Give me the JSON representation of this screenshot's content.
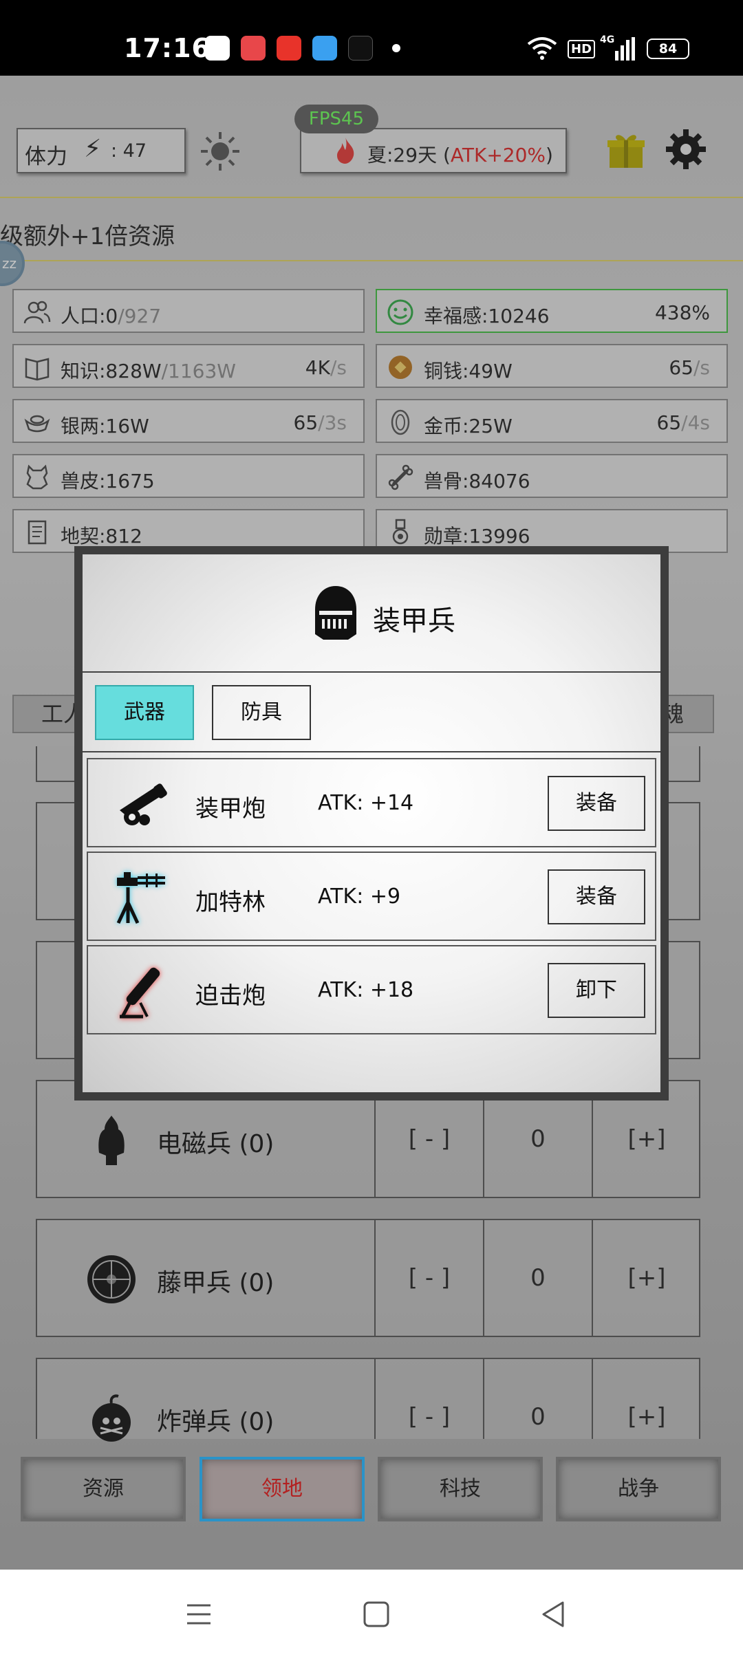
{
  "status_bar": {
    "time": "17:16",
    "network": "4G",
    "hd": "HD",
    "battery": "84"
  },
  "header": {
    "fps": "FPS45",
    "stamina_label": "体力",
    "stamina_bolt": "⚡",
    "stamina_value": ": 47",
    "season_prefix": "夏:29天 (",
    "season_atk": "ATK+20%",
    "season_suffix": ")",
    "bonus_text": "级额外+1倍资源"
  },
  "resources": {
    "population": {
      "name": "人口:0",
      "max": "/927"
    },
    "happiness": {
      "name": "幸福感:10246",
      "rate": "438%"
    },
    "knowledge": {
      "name": "知识:828W",
      "max": "/1163W",
      "rate": "4K",
      "unit": "/s"
    },
    "copper": {
      "name": "铜钱:49W",
      "rate": "65",
      "unit": "/s"
    },
    "silver": {
      "name": "银两:16W",
      "rate": "65",
      "unit": "/3s"
    },
    "gold": {
      "name": "金币:25W",
      "rate": "65",
      "unit": "/4s"
    },
    "hide": {
      "name": "兽皮:1675"
    },
    "bone": {
      "name": "兽骨:84076"
    },
    "deed": {
      "name": "地契:812"
    },
    "medal": {
      "name": "勋章:13996"
    }
  },
  "under_tabs": {
    "left": "工人",
    "right": "魂"
  },
  "units": [
    {
      "name": "电磁兵 (0)",
      "minus": "[ - ]",
      "count": "0",
      "plus": "[+]"
    },
    {
      "name": "藤甲兵 (0)",
      "minus": "[ - ]",
      "count": "0",
      "plus": "[+]"
    },
    {
      "name": "炸弹兵 (0)",
      "minus": "[ - ]",
      "count": "0",
      "plus": "[+]"
    }
  ],
  "bottom_nav": {
    "resources": "资源",
    "territory": "领地",
    "tech": "科技",
    "war": "战争"
  },
  "modal": {
    "title": "装甲兵",
    "tab_weapons": "武器",
    "tab_armor": "防具",
    "weapons": [
      {
        "name": "装甲炮",
        "atk": "ATK:  +14",
        "action": "装备"
      },
      {
        "name": "加特林",
        "atk": "ATK:  +9",
        "action": "装备"
      },
      {
        "name": "迫击炮",
        "atk": "ATK:  +18",
        "action": "卸下"
      }
    ]
  },
  "colors": {
    "accent_tab": "#66dddd",
    "fps_text": "#6cff5a",
    "atk_bonus": "#dd2222",
    "active_nav_border": "#2a93c8"
  }
}
